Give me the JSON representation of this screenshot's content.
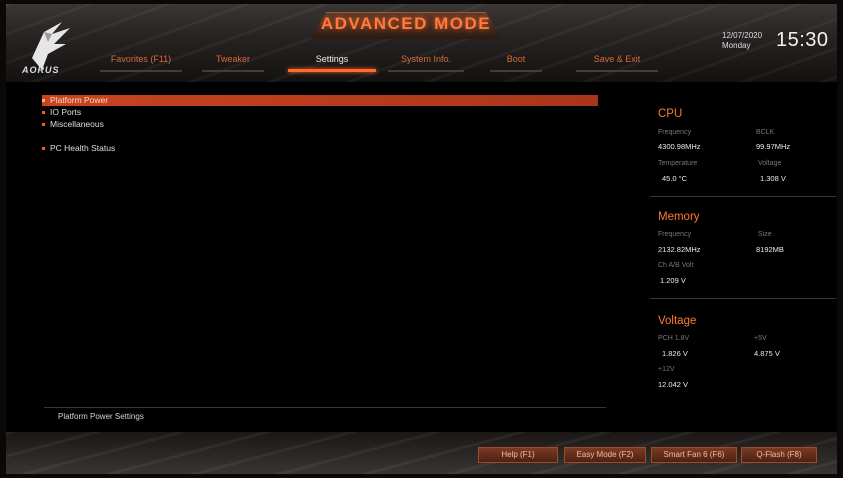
{
  "header": {
    "title": "ADVANCED MODE",
    "logo_text": "AORUS",
    "tabs": [
      {
        "label": "Favorites (F11)",
        "active": false
      },
      {
        "label": "Tweaker",
        "active": false
      },
      {
        "label": "Settings",
        "active": true
      },
      {
        "label": "System Info.",
        "active": false
      },
      {
        "label": "Boot",
        "active": false
      },
      {
        "label": "Save & Exit",
        "active": false
      }
    ],
    "date": "12/07/2020",
    "day": "Monday",
    "time": "15:30"
  },
  "menu": {
    "items": [
      {
        "label": "Platform Power",
        "selected": true
      },
      {
        "label": "IO Ports",
        "selected": false
      },
      {
        "label": "Miscellaneous",
        "selected": false
      },
      {
        "label": "PC Health Status",
        "selected": false
      }
    ]
  },
  "panel": {
    "cpu": {
      "title": "CPU",
      "frequency_label": "Frequency",
      "frequency": "4300.98MHz",
      "bclk_label": "BCLK",
      "bclk": "99.97MHz",
      "temperature_label": "Temperature",
      "temperature": "45.0 °C",
      "voltage_label": "Voltage",
      "voltage": "1.308 V"
    },
    "memory": {
      "title": "Memory",
      "frequency_label": "Frequency",
      "frequency": "2132.82MHz",
      "size_label": "Size",
      "size": "8192MB",
      "ch_volt_label": "Ch A/B Volt",
      "ch_volt": "1.209 V"
    },
    "voltage": {
      "title": "Voltage",
      "pch_label": "PCH 1.8V",
      "pch": "1.826 V",
      "v5_label": "+5V",
      "v5": "4.875 V",
      "v12_label": "+12V",
      "v12": "12.042 V"
    }
  },
  "help": {
    "text": "Platform Power Settings"
  },
  "footer": {
    "buttons": [
      {
        "label": "Help (F1)"
      },
      {
        "label": "Easy Mode (F2)"
      },
      {
        "label": "Smart Fan 6 (F6)"
      },
      {
        "label": "Q-Flash (F8)"
      }
    ]
  },
  "colors": {
    "accent": "#ff6a2a",
    "selected_row": "#c9441e",
    "panel_title": "#ff7a2e"
  }
}
